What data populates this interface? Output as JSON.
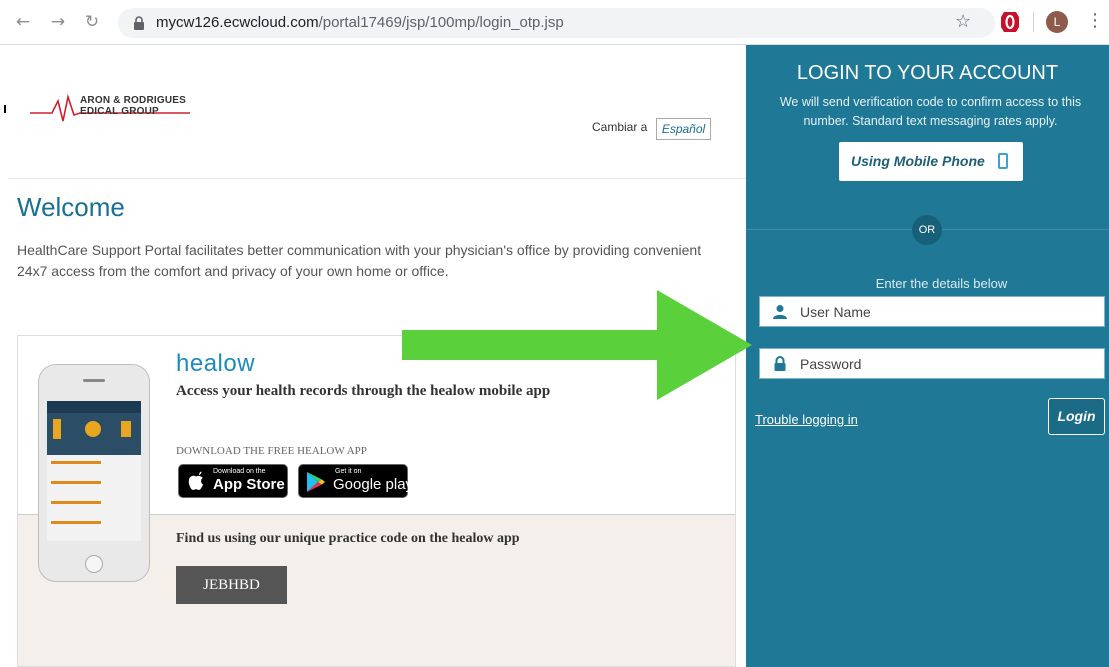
{
  "browser": {
    "url_host": "mycw126.ecwcloud.com",
    "url_path": "/portal17469/jsp/100mp/login_otp.jsp",
    "avatar_letter": "L"
  },
  "header": {
    "logo_line1": "ARON & RODRIGUES",
    "logo_line2": "EDICAL GROUP",
    "switch_label": "Cambiar a",
    "language": "Español"
  },
  "main": {
    "title": "Welcome",
    "description": "HealthCare Support Portal facilitates better communication with your physician's office by providing convenient 24x7 access from the comfort and privacy of your own home or office."
  },
  "healow_card": {
    "brand": "healow",
    "title": "Access your health records through the healow mobile app",
    "download_label": "DOWNLOAD THE FREE HEALOW APP",
    "appstore_small": "Download on the",
    "appstore_big": "App Store",
    "googleplay_small": "Get it on",
    "googleplay_big": "Google play",
    "find_label": "Find us using our unique practice code on the healow app",
    "practice_code": "JEBHBD"
  },
  "login_panel": {
    "title": "LOGIN TO YOUR ACCOUNT",
    "subtitle": "We will send verification code to confirm access to this number. Standard text messaging rates apply.",
    "mobile_button": "Using Mobile Phone",
    "or_label": "OR",
    "enter_label": "Enter the details below",
    "username_placeholder": "User Name",
    "password_placeholder": "Password",
    "trouble_link": "Trouble logging in",
    "login_button": "Login"
  },
  "colors": {
    "panel_bg": "#1e7896",
    "accent_blue": "#1a6f94",
    "arrow_green": "#5ad13a",
    "code_bg": "#555555"
  }
}
